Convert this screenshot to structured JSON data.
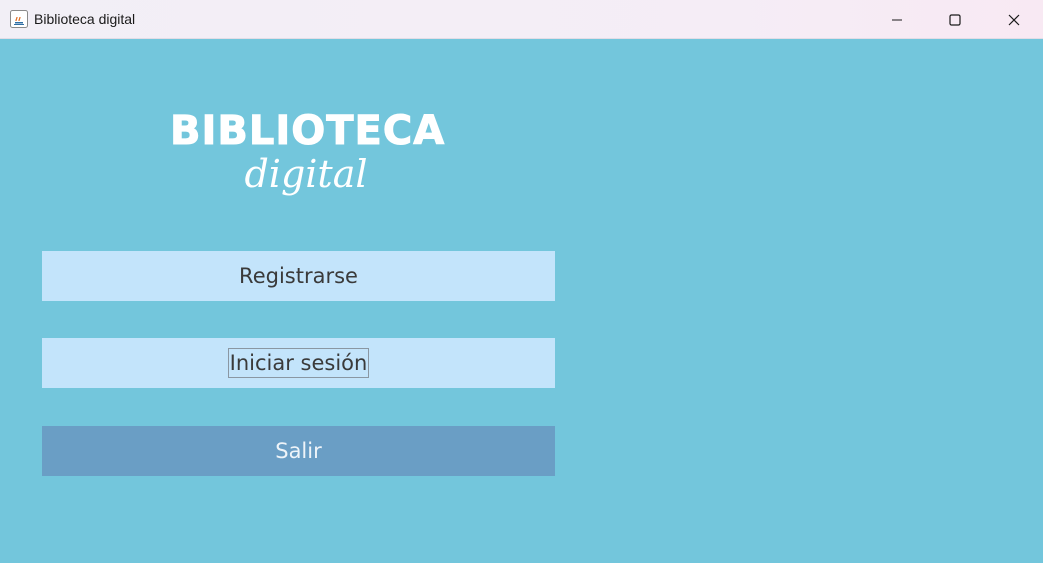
{
  "window": {
    "title": "Biblioteca digital",
    "icon": "java-icon",
    "controls": [
      "minimize-icon",
      "maximize-icon",
      "close-icon"
    ]
  },
  "logo": {
    "title": "BIBLIOTECA",
    "subtitle": "digital"
  },
  "buttons": {
    "register_label": "Registrarse",
    "login_label": "Iniciar sesión",
    "exit_label": "Salir"
  },
  "colors": {
    "background": "#73c6dc",
    "button_light": "#c3e4fb",
    "button_dark": "#6a9ec5"
  },
  "state": {
    "focused_button": "login"
  }
}
